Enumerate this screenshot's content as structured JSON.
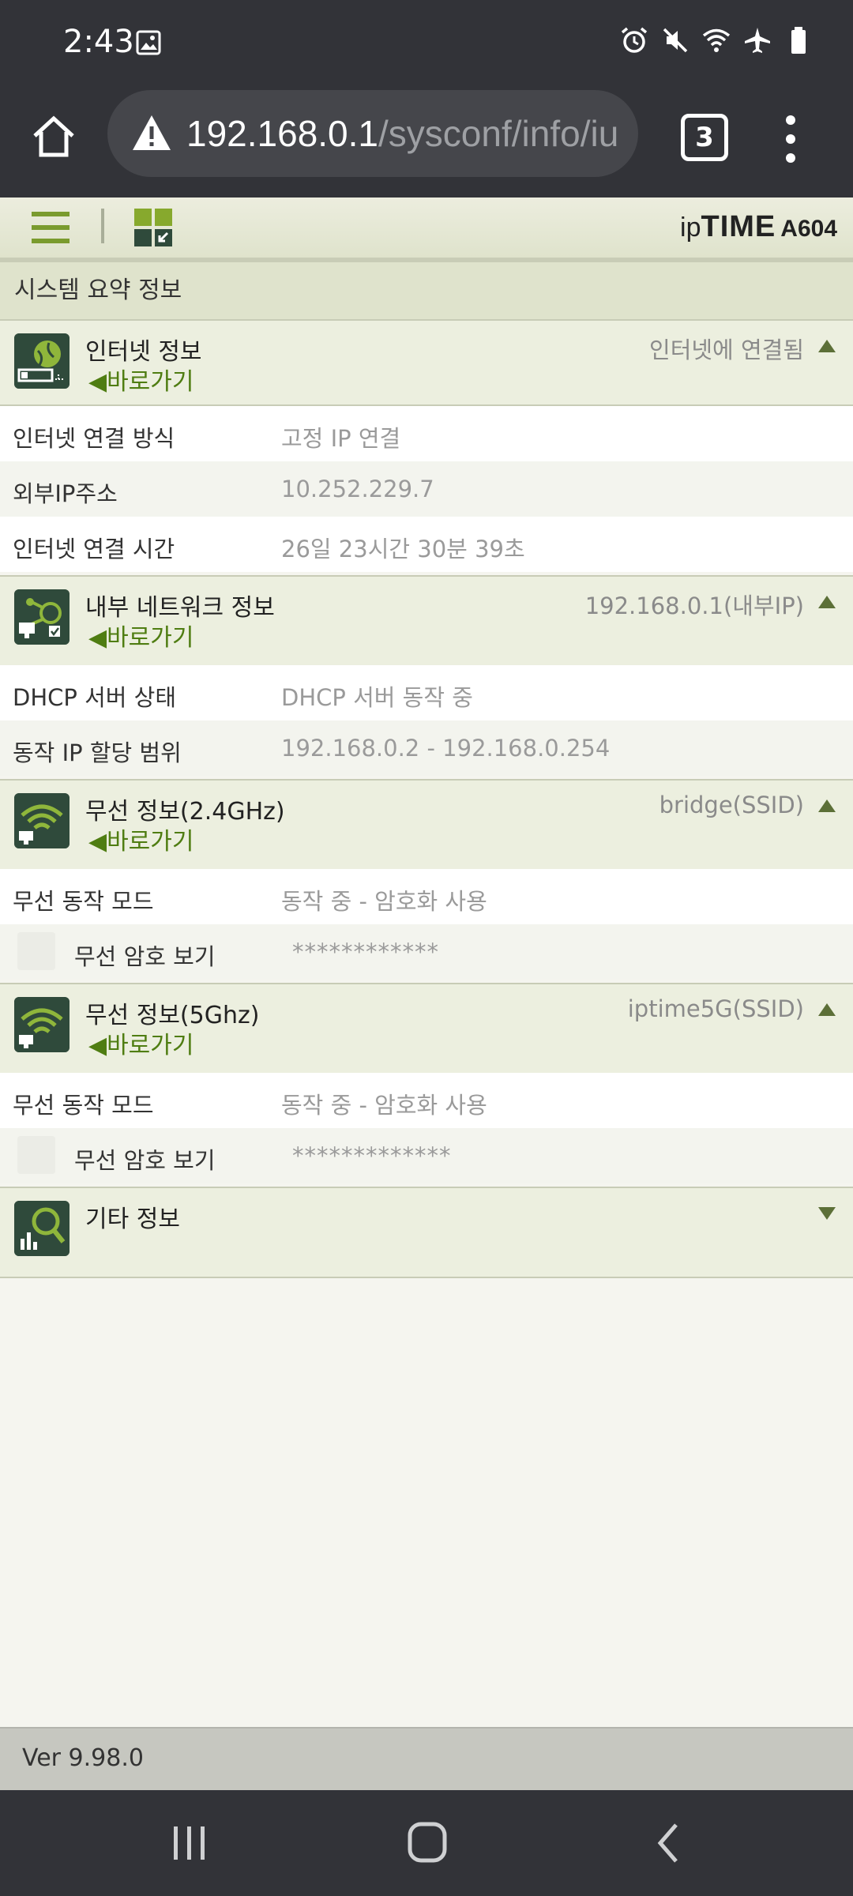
{
  "status_bar": {
    "time": "2:43"
  },
  "browser": {
    "url_host": "192.168.0.1",
    "url_path": "/sysconf/info/iu",
    "tab_count": "3"
  },
  "router": {
    "brand_ip": "ip",
    "brand_time": "TIME",
    "model": "A604",
    "page_title": "시스템 요약 정보"
  },
  "sections": {
    "internet": {
      "title": "인터넷 정보",
      "link": "◀바로가기",
      "status": "인터넷에 연결됨",
      "rows": [
        {
          "label": "인터넷 연결 방식",
          "value": "고정 IP 연결"
        },
        {
          "label": "외부IP주소",
          "value": "10.252.229.7"
        },
        {
          "label": "인터넷 연결 시간",
          "value": "26일 23시간 30분 39초"
        }
      ]
    },
    "lan": {
      "title": "내부 네트워크 정보",
      "link": "◀바로가기",
      "status": "192.168.0.1(내부IP)",
      "rows": [
        {
          "label": "DHCP 서버 상태",
          "value": "DHCP 서버 동작 중"
        },
        {
          "label": "동작 IP 할당 범위",
          "value": "192.168.0.2 - 192.168.0.254"
        }
      ]
    },
    "wifi24": {
      "title": "무선 정보(2.4GHz)",
      "link": "◀바로가기",
      "status": "bridge(SSID)",
      "mode_label": "무선 동작 모드",
      "mode_value": "동작 중 - 암호화 사용",
      "pw_label": "무선 암호 보기",
      "pw_value": "************"
    },
    "wifi5": {
      "title": "무선 정보(5Ghz)",
      "link": "◀바로가기",
      "status": "iptime5G(SSID)",
      "mode_label": "무선 동작 모드",
      "mode_value": "동작 중 - 암호화 사용",
      "pw_label": "무선 암호 보기",
      "pw_value": "*************"
    },
    "etc": {
      "title": "기타 정보"
    }
  },
  "footer": {
    "version": "Ver 9.98.0"
  }
}
